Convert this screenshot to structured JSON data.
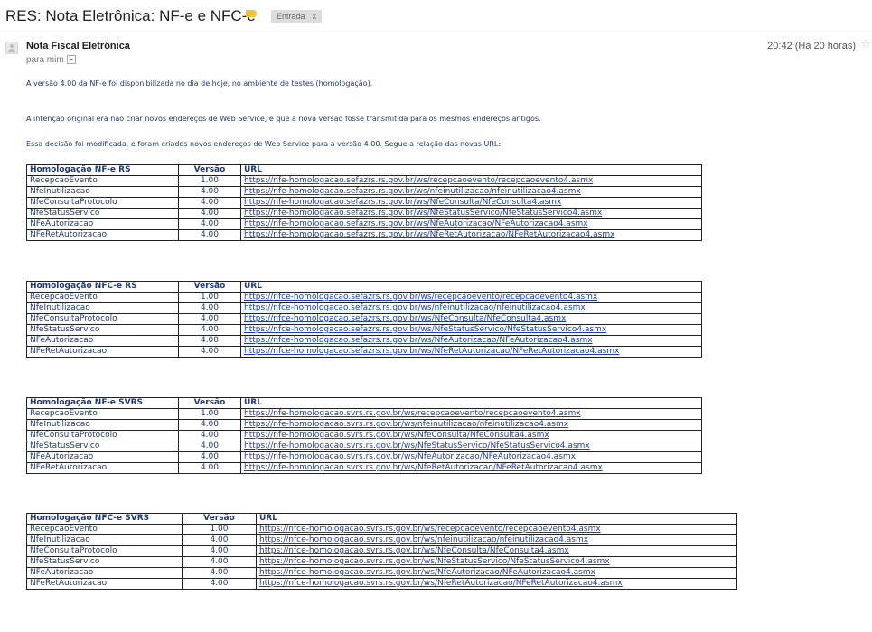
{
  "header": {
    "subject": "RES: Nota Eletrônica: NF-e e NFC-e",
    "label": "Entrada",
    "label_close": "x"
  },
  "message": {
    "sender": "Nota Fiscal Eletrônica",
    "recipient": "para mim",
    "timestamp": "20:42 (Há 20 horas)",
    "paragraphs": [
      "A versão 4.00 da NF-e foi disponibilizada no dia de hoje, no ambiente de testes (homologação).",
      "A intenção original era não criar novos endereços de Web Service, e que a nova versão fosse transmitida para os mesmos endereços antigos.",
      "Essa decisão foi modificada, e foram criados novos endereços de Web Service para a versão 4.00. Segue a relação das novas URL:"
    ]
  },
  "tables": [
    {
      "headers": [
        "Homologação NF-e RS",
        "Versão",
        "URL"
      ],
      "rows": [
        [
          "RecepcaoEvento",
          "1.00",
          "https://nfe-homologacao.sefazrs.rs.gov.br/ws/recepcaoevento/recepcaoevento4.asmx"
        ],
        [
          "NfeInutilizacao",
          "4.00",
          "https://nfe-homologacao.sefazrs.rs.gov.br/ws/nfeinutilizacao/nfeinutilizacao4.asmx"
        ],
        [
          "NfeConsultaProtocolo",
          "4.00",
          "https://nfe-homologacao.sefazrs.rs.gov.br/ws/NfeConsulta/NfeConsulta4.asmx"
        ],
        [
          "NfeStatusServico",
          "4.00",
          "https://nfe-homologacao.sefazrs.rs.gov.br/ws/NfeStatusServico/NfeStatusServico4.asmx"
        ],
        [
          "NFeAutorizacao",
          "4.00",
          "https://nfe-homologacao.sefazrs.rs.gov.br/ws/NfeAutorizacao/NFeAutorizacao4.asmx"
        ],
        [
          "NFeRetAutorizacao",
          "4.00",
          "https://nfe-homologacao.sefazrs.rs.gov.br/ws/NfeRetAutorizacao/NFeRetAutorizacao4.asmx"
        ]
      ]
    },
    {
      "headers": [
        "Homologação NFC-e RS",
        "Versão",
        "URL"
      ],
      "rows": [
        [
          "RecepcaoEvento",
          "1.00",
          "https://nfce-homologacao.sefazrs.rs.gov.br/ws/recepcaoevento/recepcaoevento4.asmx"
        ],
        [
          "NfeInutilizacao",
          "4.00",
          "https://nfce-homologacao.sefazrs.rs.gov.br/ws/nfeinutilizacao/nfeinutilizacao4.asmx"
        ],
        [
          "NfeConsultaProtocolo",
          "4.00",
          "https://nfce-homologacao.sefazrs.rs.gov.br/ws/NfeConsulta/NfeConsulta4.asmx"
        ],
        [
          "NfeStatusServico",
          "4.00",
          "https://nfce-homologacao.sefazrs.rs.gov.br/ws/NfeStatusServico/NfeStatusServico4.asmx"
        ],
        [
          "NFeAutorizacao",
          "4.00",
          "https://nfce-homologacao.sefazrs.rs.gov.br/ws/NfeAutorizacao/NFeAutorizacao4.asmx"
        ],
        [
          "NFeRetAutorizacao",
          "4.00",
          "https://nfce-homologacao.sefazrs.rs.gov.br/ws/NfeRetAutorizacao/NFeRetAutorizacao4.asmx"
        ]
      ]
    },
    {
      "headers": [
        "Homologação NF-e SVRS",
        "Versão",
        "URL"
      ],
      "rows": [
        [
          "RecepcaoEvento",
          "1.00",
          "https://nfe-homologacao.svrs.rs.gov.br/ws/recepcaoevento/recepcaoevento4.asmx"
        ],
        [
          "NfeInutilizacao",
          "4.00",
          "https://nfe-homologacao.svrs.rs.gov.br/ws/nfeinutilizacao/nfeinutilizacao4.asmx"
        ],
        [
          "NfeConsultaProtocolo",
          "4.00",
          "https://nfe-homologacao.svrs.rs.gov.br/ws/NfeConsulta/NfeConsulta4.asmx"
        ],
        [
          "NfeStatusServico",
          "4.00",
          "https://nfe-homologacao.svrs.rs.gov.br/ws/NfeStatusServico/NfeStatusServico4.asmx"
        ],
        [
          "NFeAutorizacao",
          "4.00",
          "https://nfe-homologacao.svrs.rs.gov.br/ws/NfeAutorizacao/NFeAutorizacao4.asmx"
        ],
        [
          "NFeRetAutorizacao",
          "4.00",
          "https://nfe-homologacao.svrs.rs.gov.br/ws/NfeRetAutorizacao/NFeRetAutorizacao4.asmx"
        ]
      ]
    },
    {
      "headers": [
        "Homologação NFC-e SVRS",
        "Versão",
        "URL"
      ],
      "rows": [
        [
          "RecepcaoEvento",
          "1.00",
          "https://nfce-homologacao.svrs.rs.gov.br/ws/recepcaoevento/recepcaoevento4.asmx"
        ],
        [
          "NfeInutilizacao",
          "4.00",
          "https://nfce-homologacao.svrs.rs.gov.br/ws/nfeinutilizacao/nfeinutilizacao4.asmx"
        ],
        [
          "NfeConsultaProtocolo",
          "4.00",
          "https://nfce-homologacao.svrs.rs.gov.br/ws/NfeConsulta/NfeConsulta4.asmx"
        ],
        [
          "NfeStatusServico",
          "4.00",
          "https://nfce-homologacao.svrs.rs.gov.br/ws/NfeStatusServico/NfeStatusServico4.asmx"
        ],
        [
          "NFeAutorizacao",
          "4.00",
          "https://nfce-homologacao.svrs.rs.gov.br/ws/NfeAutorizacao/NFeAutorizacao4.asmx"
        ],
        [
          "NFeRetAutorizacao",
          "4.00",
          "https://nfce-homologacao.svrs.rs.gov.br/ws/NfeRetAutorizacao/NFeRetAutorizacao4.asmx"
        ]
      ]
    }
  ]
}
